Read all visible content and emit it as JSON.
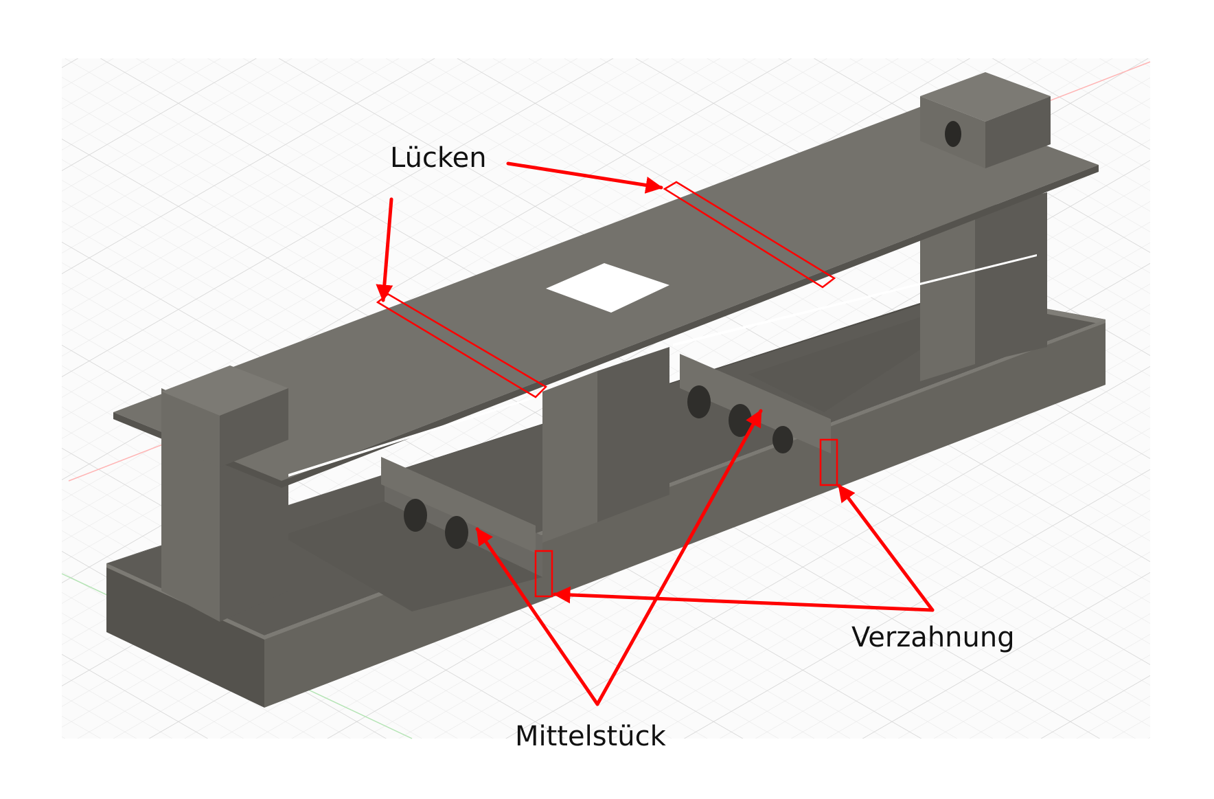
{
  "annotations": {
    "gaps_label": "Lücken",
    "interlocking_label": "Verzahnung",
    "center_piece_label": "Mittelstück"
  },
  "colors": {
    "annotation": "#ff0000",
    "panel_top": "#74726c",
    "panel_side": "#64625c",
    "panel_dark": "#56544f",
    "panel_inner": "#4e4c47",
    "grid_minor": "#e7e7e7",
    "grid_major": "#d2d2d2",
    "axis_x": "#ffb4b4",
    "axis_y": "#b4e4b4"
  }
}
